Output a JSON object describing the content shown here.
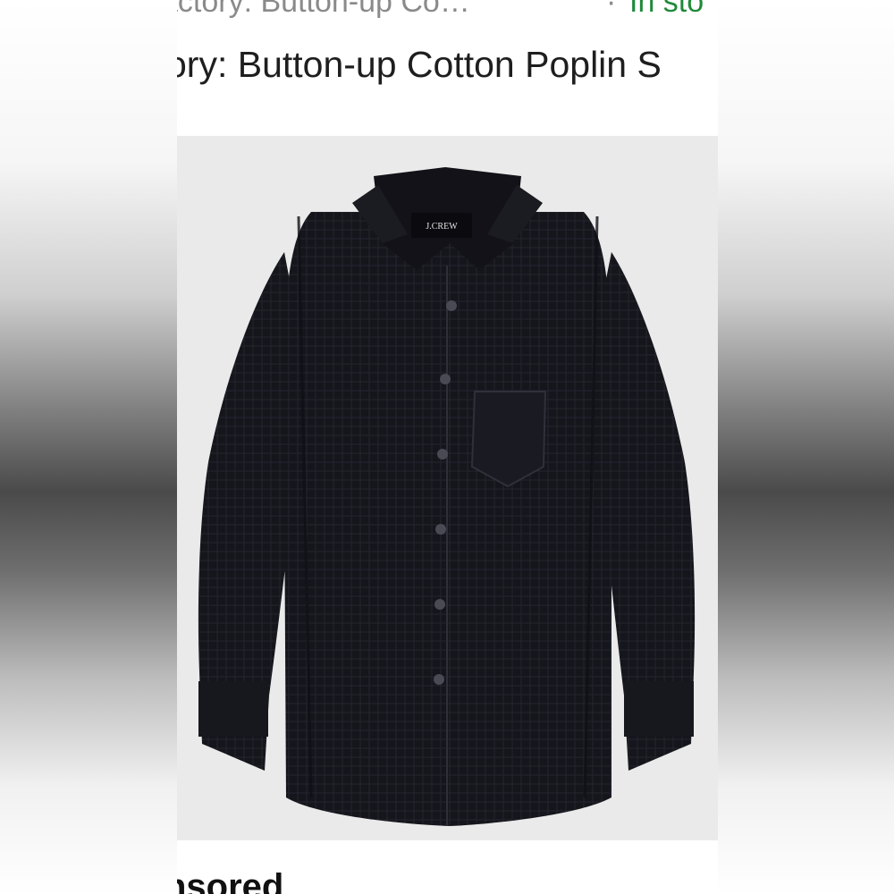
{
  "listing": {
    "top_title": "actory: Button-up Co…",
    "separator": "·",
    "stock_status": "In sto",
    "product_title": "ory: Button-up Cotton Poplin S",
    "image_alt": "Black long-sleeve button-up shirt",
    "brand_tag": "J.CREW",
    "sponsored_label": "nsored"
  },
  "colors": {
    "stock_green": "#1f8a3a",
    "title_text": "#1e1e1e",
    "muted_text": "#8a8a8a",
    "image_bg": "#eaeaea",
    "shirt": "#15151c"
  },
  "icons": {
    "separator": "middle-dot"
  }
}
